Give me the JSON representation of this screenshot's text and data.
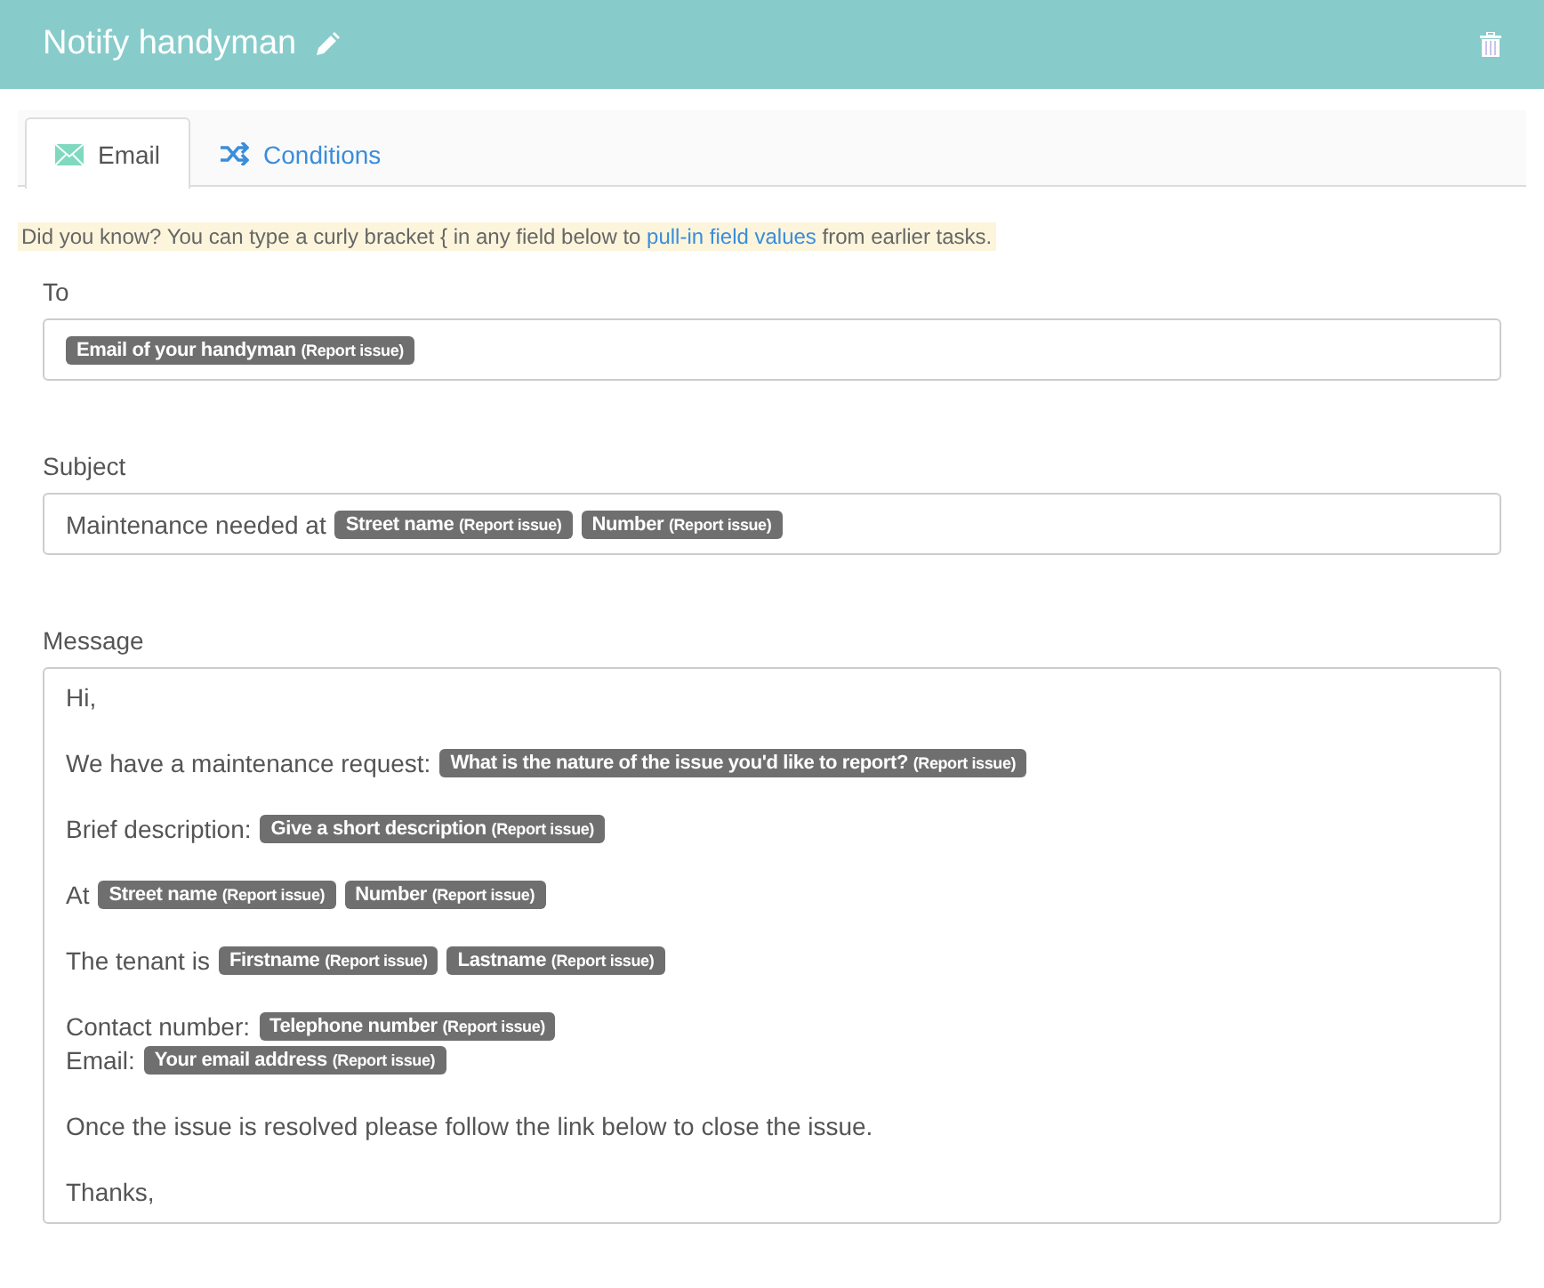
{
  "header": {
    "title": "Notify handyman"
  },
  "tabs": [
    {
      "label": "Email",
      "kind": "email",
      "selected": true
    },
    {
      "label": "Conditions",
      "kind": "conditions",
      "selected": false
    }
  ],
  "tip": {
    "before": "Did you know? You can type a curly bracket { in any field below to ",
    "link": "pull-in field values",
    "after": " from earlier tasks."
  },
  "fields": [
    {
      "label": "To",
      "kind": "single",
      "paragraphs": [
        [
          [
            {
              "kind": "token",
              "name": "Email of your handyman",
              "source": "(Report issue)"
            }
          ]
        ]
      ]
    },
    {
      "label": "Subject",
      "kind": "single",
      "paragraphs": [
        [
          [
            {
              "kind": "text",
              "text": "Maintenance needed at"
            },
            {
              "kind": "token",
              "name": "Street name",
              "source": "(Report issue)"
            },
            {
              "kind": "token",
              "name": "Number",
              "source": "(Report issue)"
            }
          ]
        ]
      ]
    },
    {
      "label": "Message",
      "kind": "multi",
      "paragraphs": [
        [
          [
            {
              "kind": "text",
              "text": "Hi,"
            }
          ]
        ],
        [
          [
            {
              "kind": "text",
              "text": "We have a maintenance request:"
            },
            {
              "kind": "token",
              "name": "What is the nature of the issue you'd like to report?",
              "source": "(Report issue)"
            }
          ]
        ],
        [
          [
            {
              "kind": "text",
              "text": "Brief description:"
            },
            {
              "kind": "token",
              "name": "Give a short description",
              "source": "(Report issue)"
            }
          ]
        ],
        [
          [
            {
              "kind": "text",
              "text": "At"
            },
            {
              "kind": "token",
              "name": "Street name",
              "source": "(Report issue)"
            },
            {
              "kind": "token",
              "name": "Number",
              "source": "(Report issue)"
            }
          ]
        ],
        [
          [
            {
              "kind": "text",
              "text": "The tenant is"
            },
            {
              "kind": "token",
              "name": "Firstname",
              "source": "(Report issue)"
            },
            {
              "kind": "token",
              "name": "Lastname",
              "source": "(Report issue)"
            }
          ]
        ],
        [
          [
            {
              "kind": "text",
              "text": "Contact number:"
            },
            {
              "kind": "token",
              "name": "Telephone number",
              "source": "(Report issue)"
            }
          ],
          [
            {
              "kind": "text",
              "text": "Email:"
            },
            {
              "kind": "token",
              "name": "Your email address",
              "source": "(Report issue)"
            }
          ]
        ],
        [
          [
            {
              "kind": "text",
              "text": "Once the issue is resolved please follow the link below to close the issue."
            }
          ]
        ],
        [
          [
            {
              "kind": "text",
              "text": "Thanks,"
            }
          ]
        ]
      ]
    }
  ]
}
